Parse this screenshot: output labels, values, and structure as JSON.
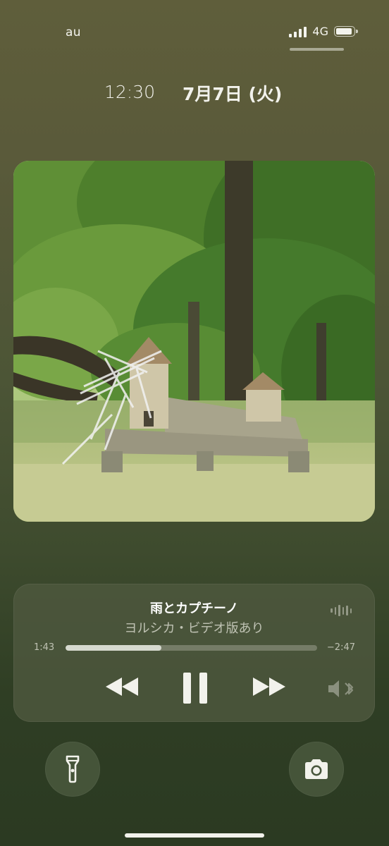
{
  "status_bar": {
    "carrier": "au",
    "network": "4G",
    "battery_level": 0.9,
    "icons": [
      "cellular-signal-icon",
      "battery-icon"
    ]
  },
  "lock_screen": {
    "time": "12:30",
    "date": "7月7日 (火)"
  },
  "now_playing": {
    "title": "雨とカプチーノ",
    "artist": "ヨルシカ・ビデオ版あり",
    "elapsed": "1:43",
    "remaining": "−2:47",
    "progress": 0.38,
    "controls": [
      "rewind-icon",
      "pause-icon",
      "fast-forward-icon",
      "audio-output-icon"
    ]
  },
  "quick_actions": {
    "left": "flashlight-icon",
    "right": "camera-icon"
  },
  "colors": {
    "background_top": "#5f5e3b",
    "background_bottom": "#2b3a22",
    "card": "#4e583e",
    "text": "#ffffff"
  }
}
